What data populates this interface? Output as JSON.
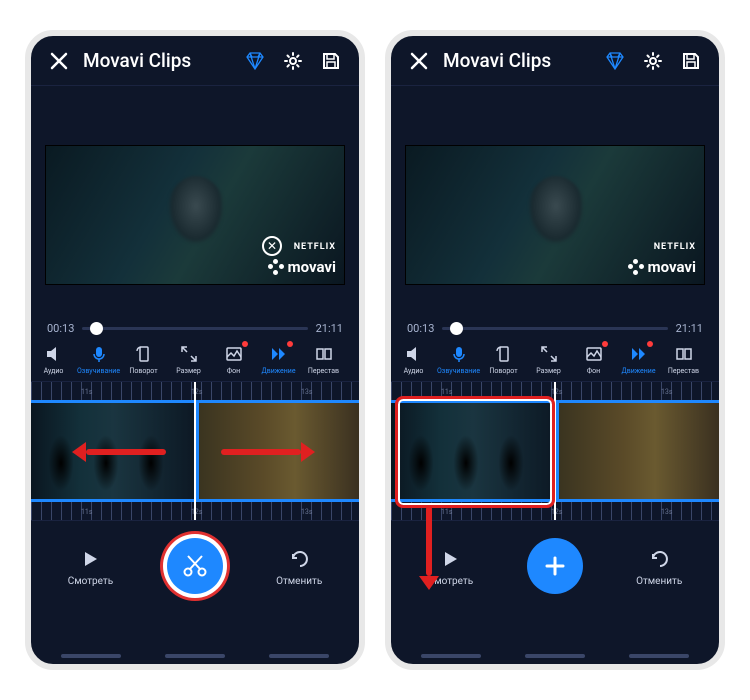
{
  "app": {
    "title": "Movavi Clips"
  },
  "watermark": {
    "brand": "movavi",
    "provider": "NETFLIX"
  },
  "time": {
    "current": "00:13",
    "total": "21:11"
  },
  "tools": [
    {
      "id": "audio",
      "label": "Аудио",
      "icon": "speaker",
      "highlight": false
    },
    {
      "id": "voice",
      "label": "Озвучивание",
      "icon": "mic",
      "highlight": true
    },
    {
      "id": "rotate",
      "label": "Поворот",
      "icon": "rotate",
      "highlight": false
    },
    {
      "id": "size",
      "label": "Размер",
      "icon": "expand",
      "highlight": false
    },
    {
      "id": "bg",
      "label": "Фон",
      "icon": "picture",
      "highlight": false,
      "badge": true
    },
    {
      "id": "motion",
      "label": "Движение",
      "icon": "forward",
      "highlight": false,
      "badge": true
    },
    {
      "id": "reorder",
      "label": "Перестав",
      "icon": "swap",
      "highlight": false
    }
  ],
  "ruler": {
    "marks": [
      "11s",
      "12s",
      "13s"
    ]
  },
  "bottom": {
    "watch": "Смотреть",
    "cancel": "Отменить"
  },
  "fab": {
    "left": "scissors",
    "right": "plus"
  },
  "colors": {
    "accent": "#1e88ff",
    "bg": "#0e1629",
    "annotate": "#e02020"
  }
}
